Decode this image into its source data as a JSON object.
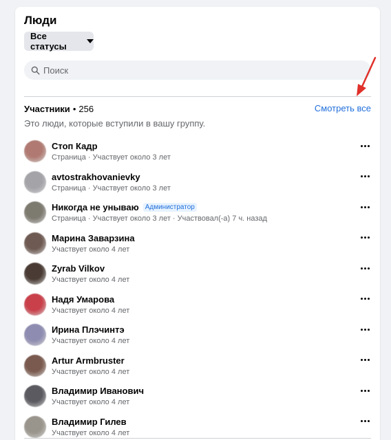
{
  "header": {
    "title": "Люди",
    "status_filter": "Все статусы",
    "search_placeholder": "Поиск"
  },
  "members_section": {
    "label": "Участники",
    "separator": "•",
    "count": "256",
    "see_all": "Смотреть все",
    "description": "Это люди, которые вступили в вашу группу."
  },
  "members": [
    {
      "name": "Стоп Кадр",
      "badge": "",
      "meta": "Страница · Участвует около 3 лет",
      "avatar_color": "#b07a72"
    },
    {
      "name": "avtostrakhovanievky",
      "badge": "",
      "meta": "Страница · Участвует около 3 лет",
      "avatar_color": "#a3a3a8"
    },
    {
      "name": "Никогда не унываю",
      "badge": "Администратор",
      "meta": "Страница · Участвует около 3 лет · Участвовал(-а) 7 ч. назад",
      "avatar_color": "#7d7a70"
    },
    {
      "name": "Марина Заварзина",
      "badge": "",
      "meta": "Участвует около 4 лет",
      "avatar_color": "#6e5a52"
    },
    {
      "name": "Zyrab Vilkov",
      "badge": "",
      "meta": "Участвует около 4 лет",
      "avatar_color": "#4a3c35"
    },
    {
      "name": "Надя Умарова",
      "badge": "",
      "meta": "Участвует около 4 лет",
      "avatar_color": "#c9404a"
    },
    {
      "name": "Ирина Плэчинтэ",
      "badge": "",
      "meta": "Участвует около 4 лет",
      "avatar_color": "#8e8cb0"
    },
    {
      "name": "Artur Armbruster",
      "badge": "",
      "meta": "Участвует около 4 лет",
      "avatar_color": "#7a5a4e"
    },
    {
      "name": "Владимир Иванович",
      "badge": "",
      "meta": "Участвует около 4 лет",
      "avatar_color": "#5a5a60"
    },
    {
      "name": "Владимир Гилев",
      "badge": "",
      "meta": "Участвует около 4 лет",
      "avatar_color": "#9a958c"
    }
  ]
}
